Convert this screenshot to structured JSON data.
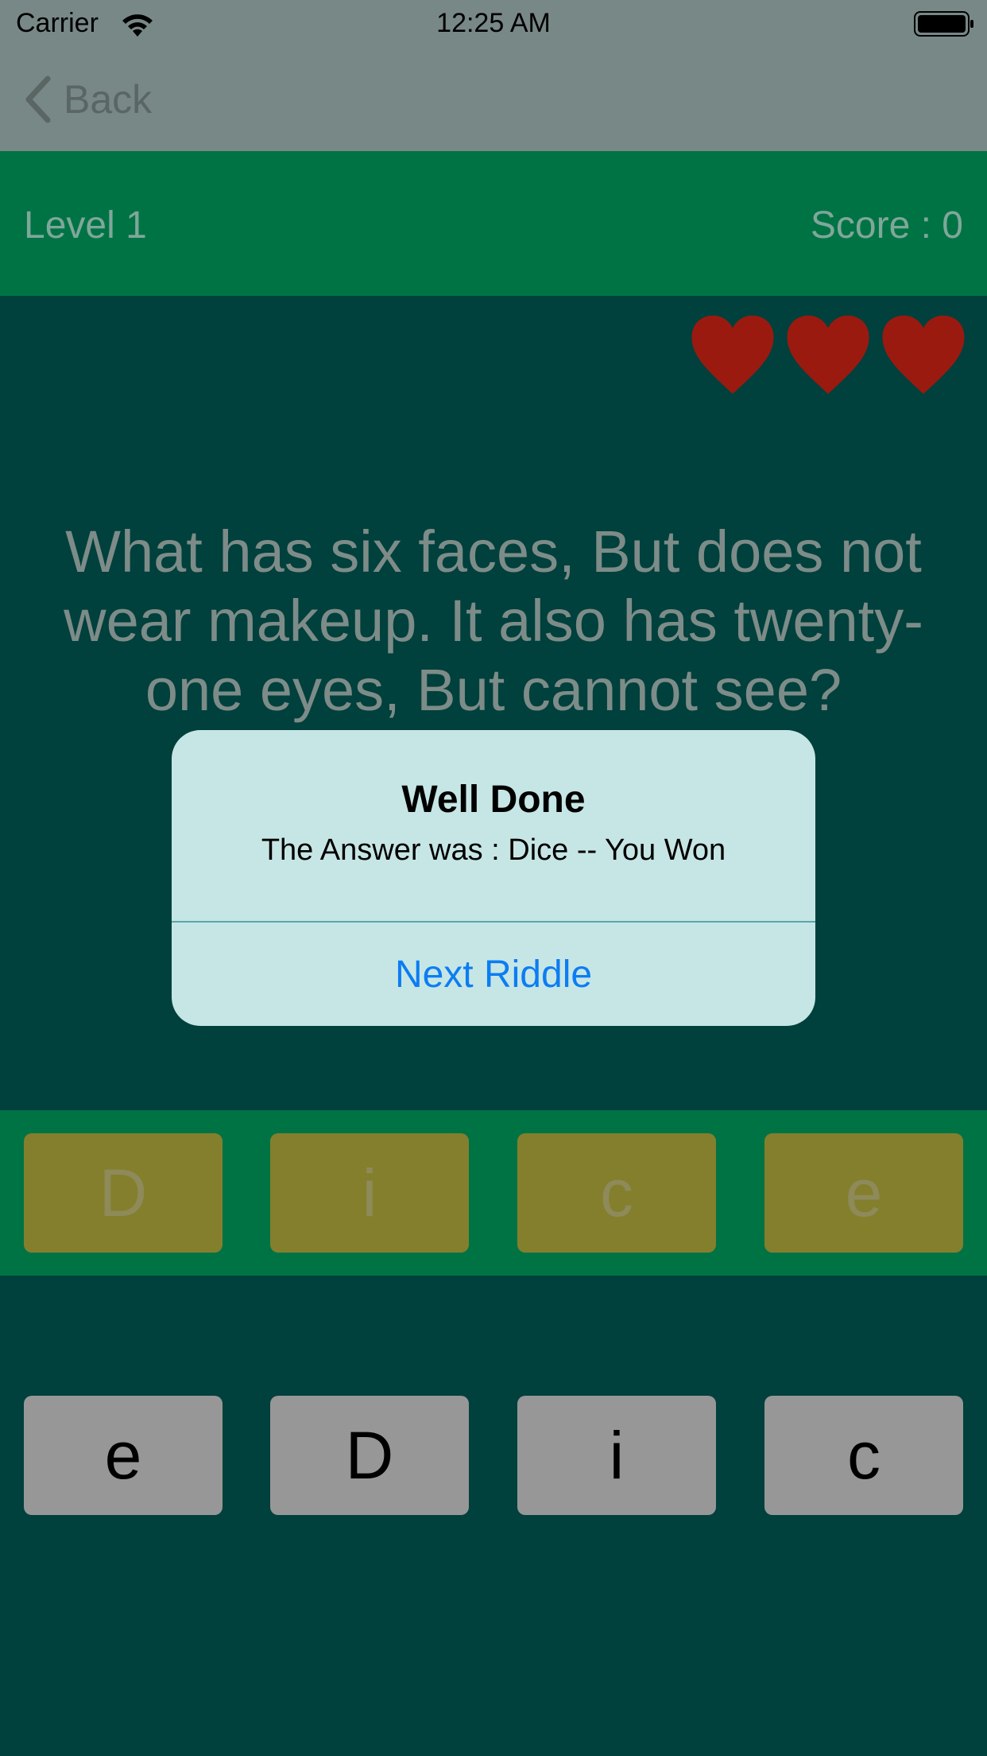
{
  "status_bar": {
    "carrier": "Carrier",
    "time": "12:25 AM",
    "wifi_icon": "wifi-icon",
    "battery_icon": "battery-icon"
  },
  "nav": {
    "back_label": "Back",
    "back_icon": "chevron-left-icon"
  },
  "game": {
    "level_label": "Level 1",
    "score_label": "Score :  0",
    "lives": 3,
    "heart_color": "#9a1a10",
    "riddle": "What has six faces, But does not wear makeup. It also has twenty-one eyes, But cannot see?",
    "answer_slots": [
      "D",
      "i",
      "c",
      "e"
    ],
    "letter_options": [
      "e",
      "D",
      "i",
      "c"
    ]
  },
  "alert": {
    "title": "Well Done",
    "message": "The Answer was : Dice -- You Won",
    "button_label": "Next Riddle",
    "button_color": "#0c7df2"
  }
}
